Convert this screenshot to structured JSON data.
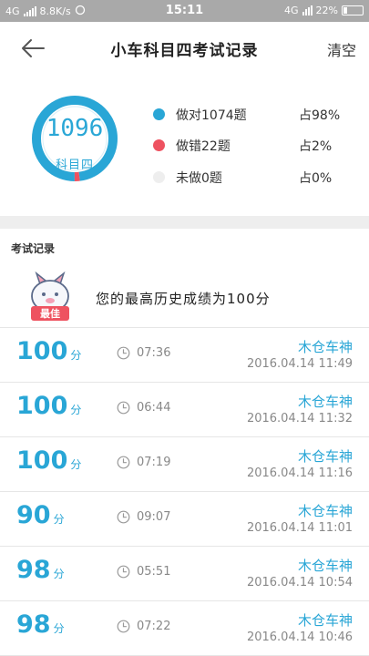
{
  "status_bar": {
    "network": "4G",
    "speed": "8.8K/s",
    "time": "15:11",
    "network_right": "4G",
    "battery": "22%"
  },
  "header": {
    "title": "小车科目四考试记录",
    "clear_label": "清空"
  },
  "summary": {
    "total": "1096",
    "subject": "科目四",
    "correct_count": 1074,
    "wrong_count": 22,
    "unanswered_count": 0,
    "legend": [
      {
        "label": "做对1074题",
        "percent": "占98%",
        "color": "#29a6d6"
      },
      {
        "label": "做错22题",
        "percent": "占2%",
        "color": "#ee5260"
      },
      {
        "label": "未做0题",
        "percent": "占0%",
        "color": "#eeeeee"
      }
    ]
  },
  "records_section": {
    "title": "考试记录",
    "best_badge": "最佳",
    "best_text": "您的最高历史成绩为100分"
  },
  "records": [
    {
      "score": "100",
      "unit": "分",
      "duration": "07:36",
      "name": "木仓车神",
      "date": "2016.04.14  11:49"
    },
    {
      "score": "100",
      "unit": "分",
      "duration": "06:44",
      "name": "木仓车神",
      "date": "2016.04.14  11:32"
    },
    {
      "score": "100",
      "unit": "分",
      "duration": "07:19",
      "name": "木仓车神",
      "date": "2016.04.14  11:16"
    },
    {
      "score": "90",
      "unit": "分",
      "duration": "09:07",
      "name": "木仓车神",
      "date": "2016.04.14  11:01"
    },
    {
      "score": "98",
      "unit": "分",
      "duration": "05:51",
      "name": "木仓车神",
      "date": "2016.04.14  10:54"
    },
    {
      "score": "98",
      "unit": "分",
      "duration": "07:22",
      "name": "木仓车神",
      "date": "2016.04.14  10:46"
    }
  ]
}
